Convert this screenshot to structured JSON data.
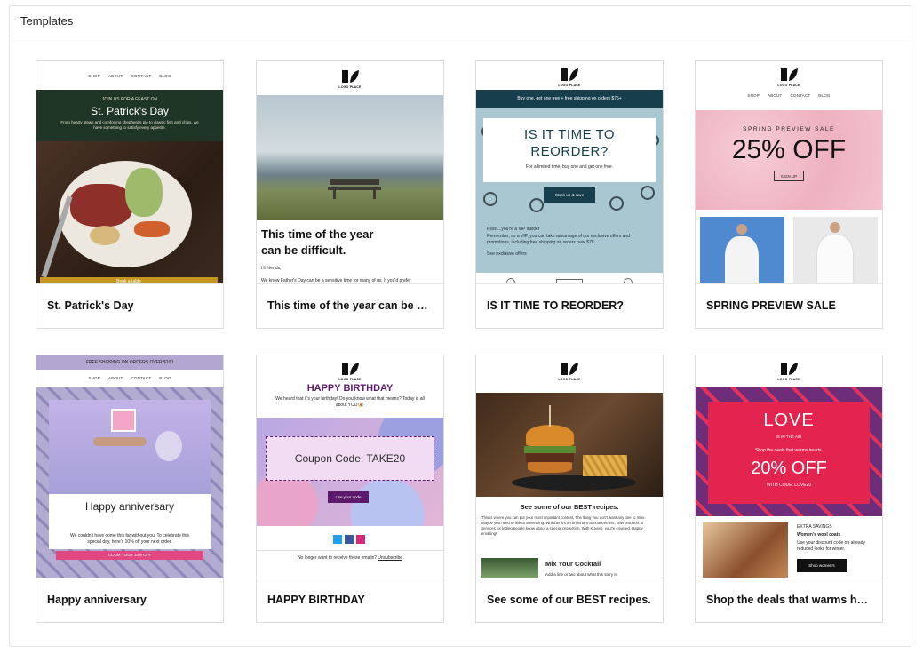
{
  "panel": {
    "title": "Templates"
  },
  "common": {
    "nav": [
      "SHOP",
      "ABOUT",
      "CONTACT",
      "BLOG"
    ],
    "logo_text": "LOGO PLACE"
  },
  "cards": [
    {
      "title": "St. Patrick's Day",
      "kicker": "JOIN US FOR A FEAST ON",
      "headline": "St. Patrick's Day",
      "body": "From hearty stews and comforting shepherd's pie to classic fish and chips, we have something to satisfy every appetite.",
      "cta": "Book a table"
    },
    {
      "title": "This time of the year can be difficult.",
      "headline": "This time of the year can be difficult.",
      "greeting": "Hi friends,",
      "body": "We know Father's Day can be a sensitive time for many of us. If you'd prefer"
    },
    {
      "title": "IS IT TIME TO REORDER?",
      "banner": "Buy one, get one free + free shipping on orders $75+",
      "headline": "IS IT TIME TO REORDER?",
      "sub": "For a limited time, buy one and get one free.",
      "cta": "Stock up & save",
      "insider": "Pssst...you're a VIP insider",
      "body": "Remember, as a VIP, you can take advantage of our exclusive offers and promotions, including free shipping on orders over $75.",
      "link": "See exclusive offers"
    },
    {
      "title": "SPRING PREVIEW SALE",
      "kicker": "SPRING PREVIEW SALE",
      "headline": "25% OFF",
      "cta": "SIGN UP"
    },
    {
      "title": "Happy anniversary",
      "banner": "FREE SHIPPING ON ORDERS OVER $100",
      "headline": "Happy anniversary",
      "body": "We couldn't have come this far without you. To celebrate this special day, here's 10% off your next order.",
      "cta": "CLAIM YOUR 10% OFF"
    },
    {
      "title": "HAPPY BIRTHDAY",
      "headline": "HAPPY BIRTHDAY",
      "sub": "We heard that it's your birthday! Do you know what that means? Today is all about YOU!🎉",
      "coupon": "Coupon Code: TAKE20",
      "cta": "Use your code",
      "footer": "No longer want to receive these emails?",
      "unsubscribe": "Unsubscribe"
    },
    {
      "title": "See some of our BEST recipes.",
      "headline": "See some of our BEST recipes.",
      "body": "This is where you can put your most important content. The thing you don't want any one to miss. Maybe you need to link to something. Whether it's an important announcement, new products or services, or letting people know about a special promotion. With Klaviyo, you're covered. Happy emailing!",
      "sub_title": "Mix Your Cocktail",
      "sub_body": "Add a line or two about what this story is"
    },
    {
      "title": "Shop the deals that warms hearts.",
      "headline": "LOVE",
      "kicker": "IS IN THE AIR",
      "body": "Shop the deals that warms hearts.",
      "offer": "20% OFF",
      "code": "WITH CODE: LOVE20",
      "extra": "EXTRA SAVINGS",
      "product": "Women's wool coats",
      "product_body": "Use your discount code on already reduced looks for winter.",
      "cta": "Shop women's"
    }
  ]
}
